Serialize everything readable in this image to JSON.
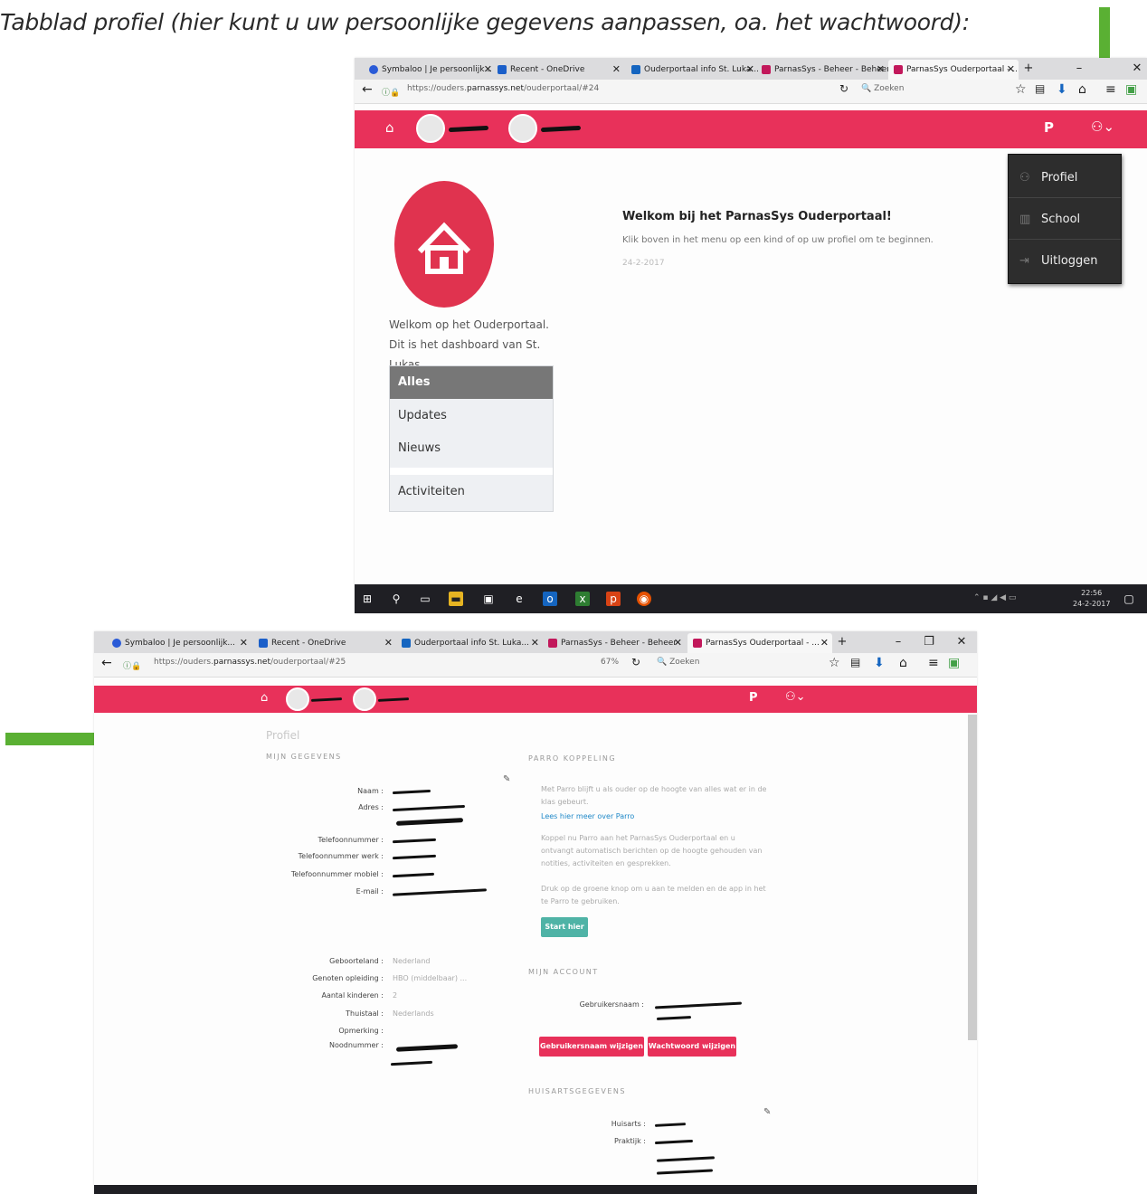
{
  "caption": "Tabblad profiel (hier kunt u uw persoonlijke gegevens aanpassen, oa. het wachtwoord):",
  "colors": {
    "brand_pink": "#e8315a",
    "arrow_green": "#5ab033",
    "teal_button": "#4fb3a6",
    "dark_menu": "#2d2d2d"
  },
  "top": {
    "tabs": [
      {
        "label": "Symbaloo | Je persoonlijk...",
        "icon": "symbaloo-icon"
      },
      {
        "label": "Recent - OneDrive",
        "icon": "onedrive-icon"
      },
      {
        "label": "Ouderportaal info St. Luka...",
        "icon": "outlook-icon"
      },
      {
        "label": "ParnasSys - Beheer - Beheer",
        "icon": "parnassys-icon"
      },
      {
        "label": "ParnasSys Ouderportaal - ...",
        "icon": "parnassys-icon"
      }
    ],
    "url_prefix": "https://ouders.",
    "url_host": "parnassys.net",
    "url_path": "/ouderportaal/#24",
    "search_placeholder": "Zoeken",
    "menu": {
      "profiel": "Profiel",
      "school": "School",
      "uitloggen": "Uitloggen"
    },
    "welcome_heading": "Welkom bij het ParnasSys Ouderportaal!",
    "welcome_text": "Klik boven in het menu op een kind of op uw profiel om te beginnen.",
    "welcome_date": "24-2-2017",
    "dashboard_text": "Welkom op het Ouderportaal. Dit is het dashboard van St. Lukas.",
    "filters": {
      "alles": "Alles",
      "updates": "Updates",
      "nieuws": "Nieuws",
      "activiteiten": "Activiteiten"
    },
    "clock_time": "22:56",
    "clock_date": "24-2-2017"
  },
  "bottom": {
    "tabs": [
      {
        "label": "Symbaloo | Je persoonlijk...",
        "icon": "symbaloo-icon"
      },
      {
        "label": "Recent - OneDrive",
        "icon": "onedrive-icon"
      },
      {
        "label": "Ouderportaal info St. Luka...",
        "icon": "outlook-icon"
      },
      {
        "label": "ParnasSys - Beheer - Beheer",
        "icon": "parnassys-icon"
      },
      {
        "label": "ParnasSys Ouderportaal - ...",
        "icon": "parnassys-icon"
      }
    ],
    "url_prefix": "https://ouders.",
    "url_host": "parnassys.net",
    "url_path": "/ouderportaal/#25",
    "zoom": "67%",
    "search_placeholder": "Zoeken",
    "page_title": "Profiel",
    "mijn_gegevens": "MIJN GEGEVENS",
    "fields": {
      "naam": "Naam :",
      "adres": "Adres :",
      "telefoon": "Telefoonnummer :",
      "telefoon_werk": "Telefoonnummer werk :",
      "telefoon_mobiel": "Telefoonnummer mobiel :",
      "email": "E-mail :",
      "geboorteland": "Geboorteland :",
      "genoten_opleiding": "Genoten opleiding :",
      "aantal_kinderen": "Aantal kinderen :",
      "thuistaal": "Thuistaal :",
      "opmerking": "Opmerking :",
      "noodnummer": "Noodnummer :"
    },
    "values": {
      "geboorteland": "Nederland",
      "genoten_opleiding": "HBO (middelbaar) ...",
      "aantal_kinderen": "2",
      "thuistaal": "Nederlands"
    },
    "parro_heading": "PARRO KOPPELING",
    "parro_p1": "Met Parro blijft u als ouder op de hoogte van alles wat er in de klas gebeurt.",
    "parro_link": "Lees hier meer over Parro",
    "parro_p2": "Koppel nu Parro aan het ParnasSys Ouderportaal en u ontvangt automatisch berichten op de hoogte gehouden van notities, activiteiten en gesprekken.",
    "parro_p3": "Druk op de groene knop om u aan te melden en de app in het te Parro te gebruiken.",
    "start_button": "Start hier",
    "account_heading": "MIJN ACCOUNT",
    "gebruikersnaam_label": "Gebruikersnaam :",
    "btn_username": "Gebruikersnaam wijzigen",
    "btn_password": "Wachtwoord wijzigen",
    "huisarts_heading": "HUISARTSGEGEVENS",
    "huisarts_label": "Huisarts :",
    "praktijk_label": "Praktijk :"
  }
}
